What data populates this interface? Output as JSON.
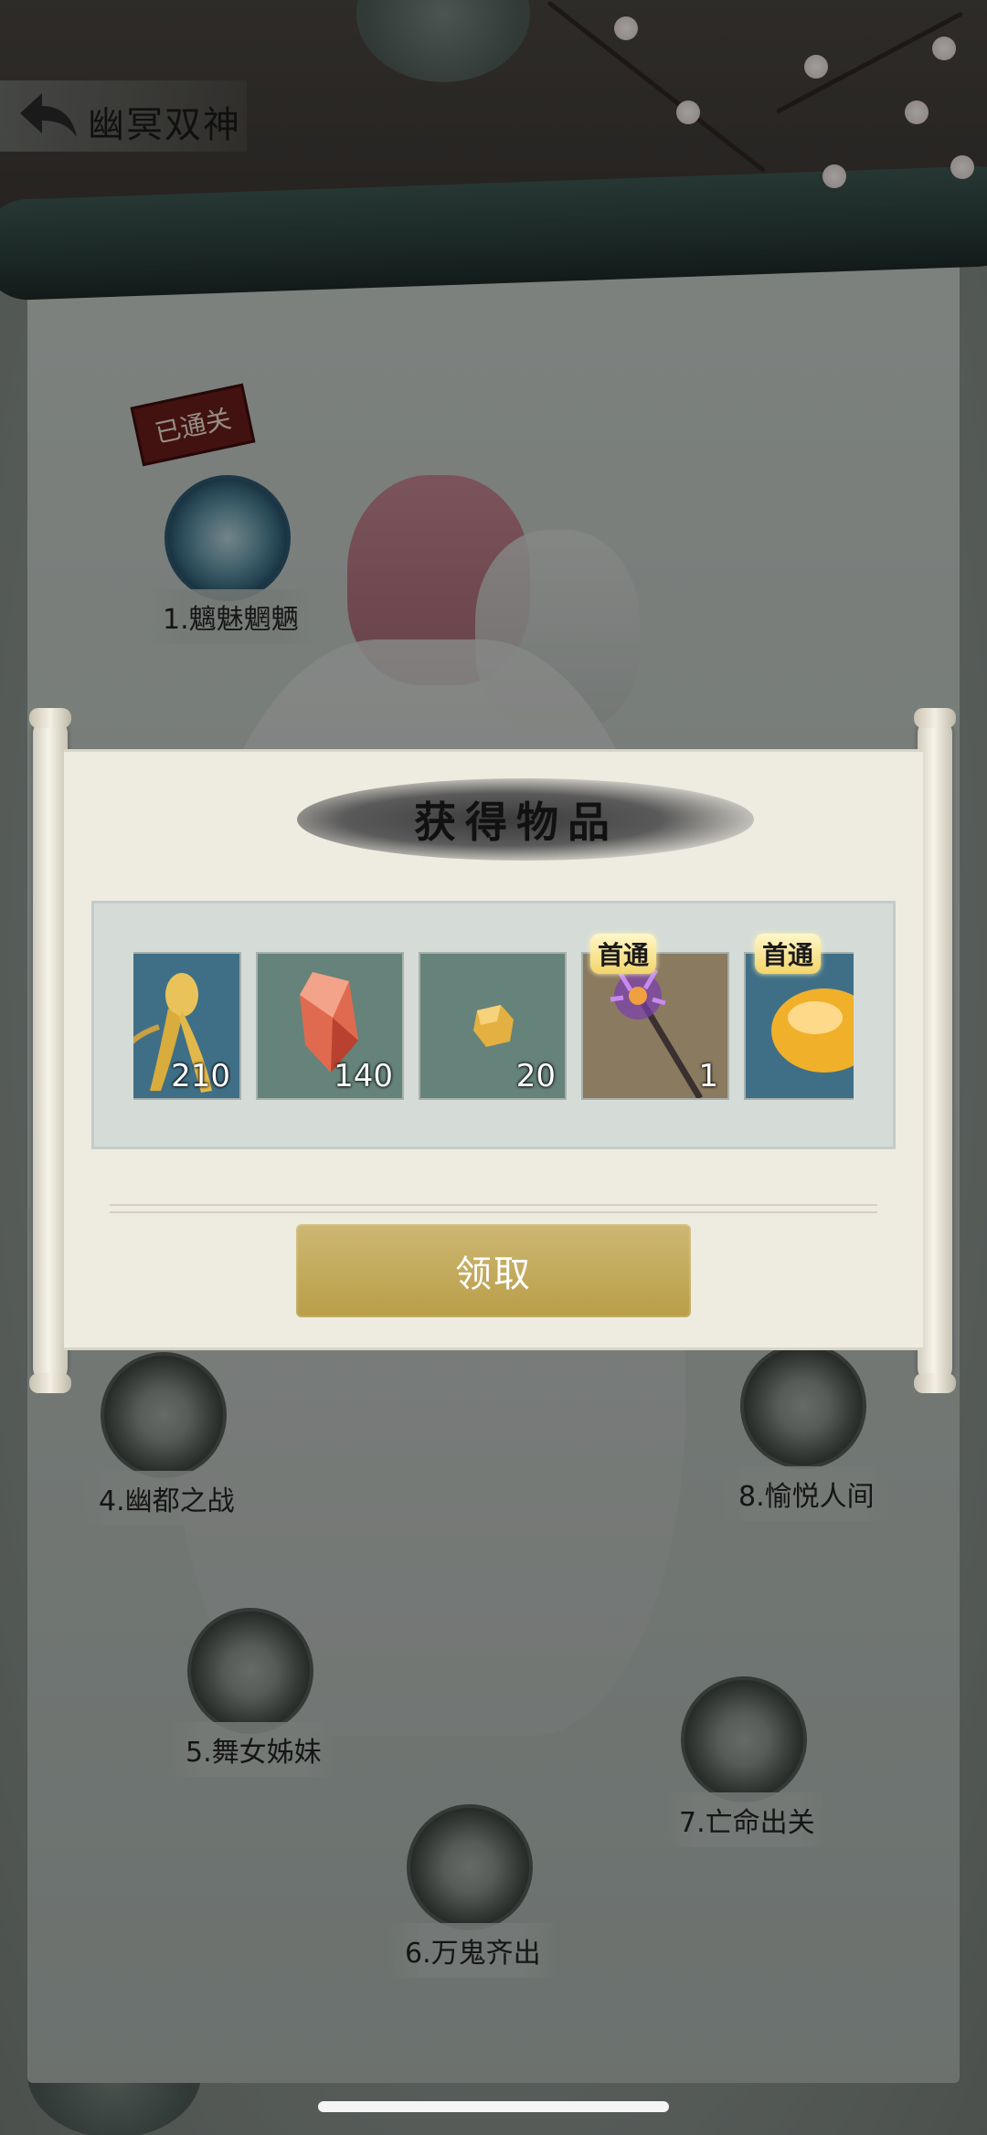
{
  "header": {
    "back_icon": "back-arrow-icon",
    "title": "幽冥双神"
  },
  "map": {
    "completed_badge": "已通关",
    "stages": [
      {
        "label": "1.魑魅魍魉",
        "completed": true
      },
      {
        "label": "4.幽都之战",
        "completed": false
      },
      {
        "label": "8.愉悦人间",
        "completed": false
      },
      {
        "label": "5.舞女姊妹",
        "completed": false
      },
      {
        "label": "7.亡命出关",
        "completed": false
      },
      {
        "label": "6.万鬼齐出",
        "completed": false
      }
    ]
  },
  "dialog": {
    "title": "获得物品",
    "first_clear_tag": "首通",
    "items": [
      {
        "icon": "ginseng-icon",
        "count": "210",
        "first_clear": false
      },
      {
        "icon": "red-crystal-icon",
        "count": "140",
        "first_clear": false
      },
      {
        "icon": "gold-nugget-icon",
        "count": "20",
        "first_clear": false
      },
      {
        "icon": "purple-staff-icon",
        "count": "1",
        "first_clear": true
      },
      {
        "icon": "gold-orb-icon",
        "count": "",
        "first_clear": true
      }
    ],
    "claim_label": "领取"
  },
  "colors": {
    "accent_gold": "#c2a85a",
    "completed_badge": "#6b1e1a",
    "dialog_bg": "#eeebe0"
  }
}
